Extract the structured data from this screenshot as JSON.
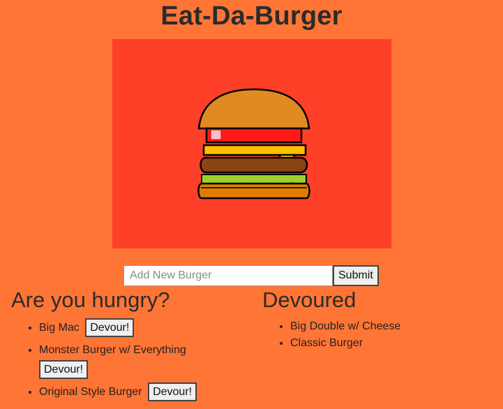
{
  "title": "Eat-Da-Burger",
  "hero": {
    "icon": "burger-illustration",
    "colors": {
      "background": "#ff4028",
      "bun": "#e08a22",
      "tomato": "#ff1a1a",
      "cheese": "#ffc000",
      "patty": "#8b4513",
      "lettuce": "#9ad22a"
    }
  },
  "form": {
    "placeholder": "Add New Burger",
    "submit_label": "Submit"
  },
  "hungry": {
    "heading": "Are you hungry?",
    "items": [
      {
        "name": "Big Mac",
        "button": "Devour!"
      },
      {
        "name": "Monster Burger w/ Everything",
        "button": "Devour!"
      },
      {
        "name": "Original Style Burger",
        "button": "Devour!"
      }
    ]
  },
  "devoured": {
    "heading": "Devoured",
    "items": [
      {
        "name": "Big Double w/ Cheese"
      },
      {
        "name": "Classic Burger"
      }
    ]
  },
  "colors": {
    "page_background": "#ff7535"
  }
}
